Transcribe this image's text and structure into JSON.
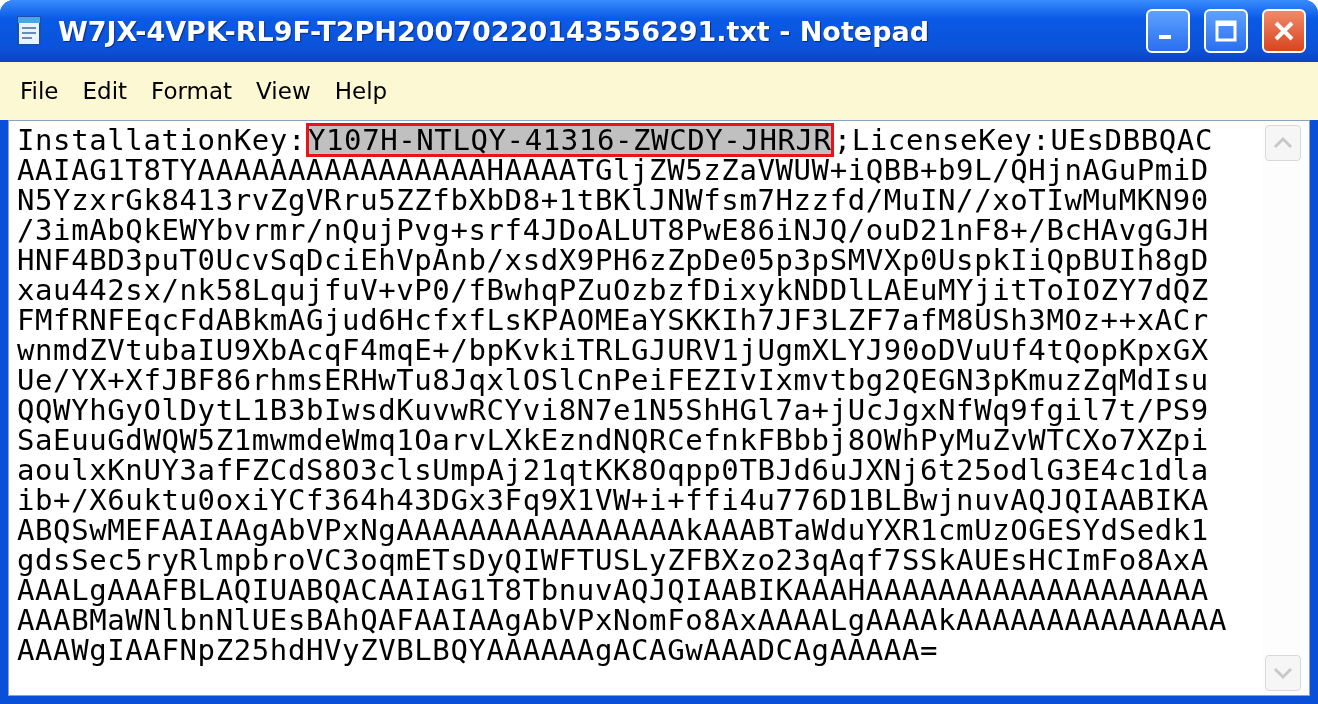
{
  "window": {
    "title": "W7JX-4VPK-RL9F-T2PH20070220143556291.txt - Notepad"
  },
  "menu": [
    "File",
    "Edit",
    "Format",
    "View",
    "Help"
  ],
  "editor": {
    "first_line": {
      "prefix": "InstallationKey:",
      "selection": "Y107H-NTLQY-41316-ZWCDY-JHRJR",
      "suffix": ";LicenseKey:UEsDBBQAC"
    },
    "lines": [
      "AAIAG1T8TYAAAAAAAAAAAAAAAAHAAAATGljZW5zZaVWUW+iQBB+b9L/QHjnAGuPmiD",
      "N5YzxrGk8413rvZgVRru5ZZfbXbD8+1tBKlJNWfsm7Hzzfd/MuIN//xoTIwMuMKN90",
      "/3imAbQkEWYbvrmr/nQujPvg+srf4JDoALUT8PwE86iNJQ/ouD21nF8+/BcHAvgGJH",
      "HNF4BD3puT0UcvSqDciEhVpAnb/xsdX9PH6zZpDe05p3pSMVXp0UspkIiQpBUIh8gD",
      "xau442sx/nk58LqujfuV+vP0/fBwhqPZuOzbzfDixykNDDlLAEuMYjitToIOZY7dQZ",
      "FMfRNFEqcFdABkmAGjud6HcfxfLsKPAOMEaYSKKIh7JF3LZF7afM8USh3MOz++xACr",
      "wnmdZVtubaIU9XbAcqF4mqE+/bpKvkiTRLGJURV1jUgmXLYJ90oDVuUf4tQopKpxGX",
      "Ue/YX+XfJBF86rhmsERHwTu8JqxlOSlCnPeiFEZIvIxmvtbg2QEGN3pKmuzZqMdIsu",
      "QQWYhGyOlDytL1B3bIwsdKuvwRCYvi8N7e1N5ShHGl7a+jUcJgxNfWq9fgil7t/PS9",
      "SaEuuGdWQW5Z1mwmdeWmq1OarvLXkEzndNQRCefnkFBbbj8OWhPyMuZvWTCXo7XZpi",
      "aoulxKnUY3afFZCdS8O3clsUmpAj21qtKK8Oqpp0TBJd6uJXNj6t25odlG3E4c1dla",
      "ib+/X6uktu0oxiYCf364h43DGx3Fq9X1VW+i+ffi4u776D1BLBwjnuvAQJQIAABIKA",
      "ABQSwMEFAAIAAgAbVPxNgAAAAAAAAAAAAAAAAkAAABTaWduYXR1cmUzOGESYdSedk1",
      "gdsSec5ryRlmpbroVC3oqmETsDyQIWFTUSLyZFBXzo23qAqf7SSkAUEsHCImFo8AxA",
      "AAALgAAAFBLAQIUABQACAAIAG1T8TbnuvAQJQIAABIKAAAHAAAAAAAAAAAAAAAAAAA",
      "AAABMaWNlbnNlUEsBAhQAFAAIAAgAbVPxNomFo8AxAAAALgAAAAkAAAAAAAAAAAAAAA",
      "AAAWgIAAFNpZ25hdHVyZVBLBQYAAAAAAgACAGwAAADCAgAAAAA="
    ]
  }
}
